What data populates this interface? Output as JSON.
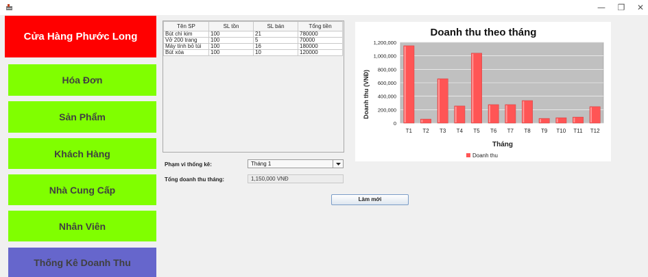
{
  "window": {
    "buttons": {
      "minimize": "—",
      "maximize": "❐",
      "close": "✕"
    }
  },
  "sidebar": {
    "store_name": "Cửa Hàng Phước Long",
    "items": [
      {
        "label": "Hóa Đơn"
      },
      {
        "label": "Sản Phẩm"
      },
      {
        "label": "Khách Hàng"
      },
      {
        "label": "Nhà Cung Cấp"
      },
      {
        "label": "Nhân Viên"
      },
      {
        "label": "Thống Kê Doanh Thu"
      }
    ],
    "colors": {
      "header": "#ff0000",
      "item": "#80ff00",
      "active": "#6666cc"
    }
  },
  "table": {
    "headers": [
      "Tên SP",
      "SL tồn",
      "SL bán",
      "Tổng tiền"
    ],
    "rows": [
      [
        "Bút chì kim",
        "100",
        "21",
        "780000"
      ],
      [
        "Vở 200 trang",
        "100",
        "5",
        "70000"
      ],
      [
        "Máy tính bỏ túi",
        "100",
        "16",
        "180000"
      ],
      [
        "Bút xóa",
        "100",
        "10",
        "120000"
      ]
    ]
  },
  "form": {
    "scope_label": "Phạm vi thống kê:",
    "scope_value": "Tháng 1",
    "total_label": "Tổng doanh thu tháng:",
    "total_value": "1,150,000 VNĐ",
    "refresh_label": "Làm mới"
  },
  "chart_data": {
    "type": "bar",
    "title": "Doanh thu theo tháng",
    "xlabel": "Tháng",
    "ylabel": "Doanh thu (VNĐ)",
    "categories": [
      "T1",
      "T2",
      "T3",
      "T4",
      "T5",
      "T6",
      "T7",
      "T8",
      "T9",
      "T10",
      "T11",
      "T12"
    ],
    "series": [
      {
        "name": "Doanh thu",
        "values": [
          1150000,
          60000,
          660000,
          255000,
          1040000,
          275000,
          275000,
          335000,
          70000,
          80000,
          90000,
          245000
        ],
        "color": "#ff5555"
      }
    ],
    "ylim": [
      0,
      1200000
    ],
    "yticks": [
      0,
      200000,
      400000,
      600000,
      800000,
      1000000,
      1200000
    ],
    "ytick_labels": [
      "0",
      "200,000",
      "400,000",
      "600,000",
      "800,000",
      "1,000,000",
      "1,200,000"
    ],
    "grid": true,
    "legend_position": "bottom",
    "plot_background": "#c0c0c0"
  }
}
